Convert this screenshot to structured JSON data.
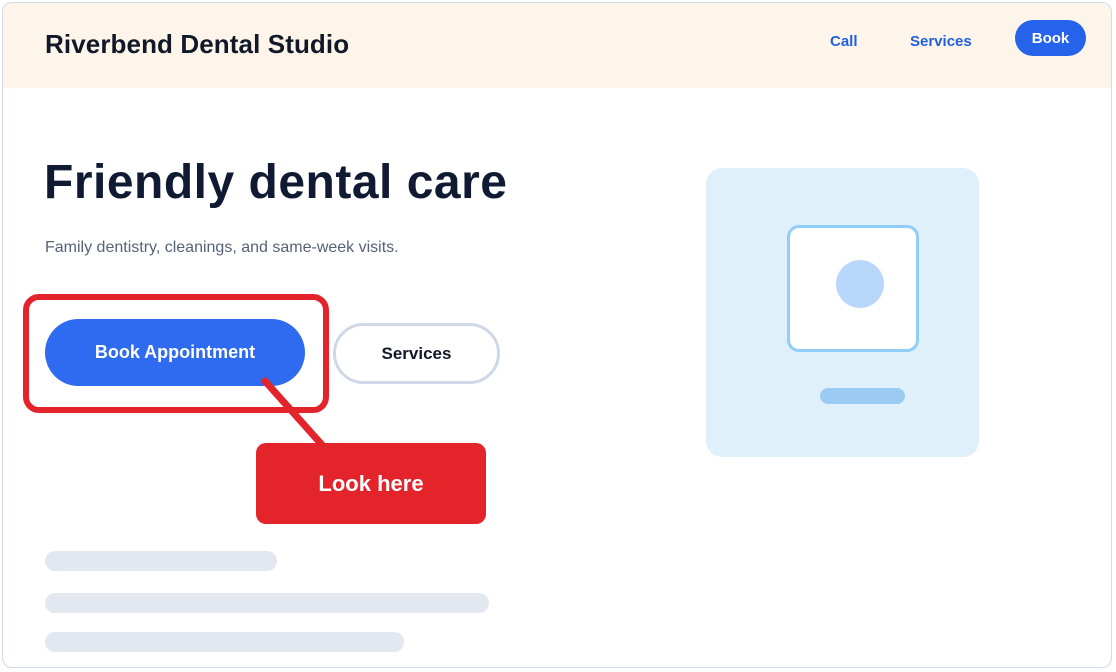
{
  "header": {
    "brand": "Riverbend Dental Studio",
    "nav": {
      "call": "Call",
      "services": "Services",
      "book": "Book"
    }
  },
  "hero": {
    "title": "Friendly dental care",
    "subtitle": "Family dentistry, cleanings, and same-week visits.",
    "primary_button": "Book Appointment",
    "secondary_button": "Services"
  },
  "annotation": {
    "callout_label": "Look here"
  },
  "colors": {
    "header_bg": "#fef5ea",
    "brand_blue": "#2563eb",
    "annotation_red": "#e3242b",
    "illustration_bg": "#e0f0fb"
  },
  "icons": {
    "illustration": "image-placeholder-icon"
  }
}
